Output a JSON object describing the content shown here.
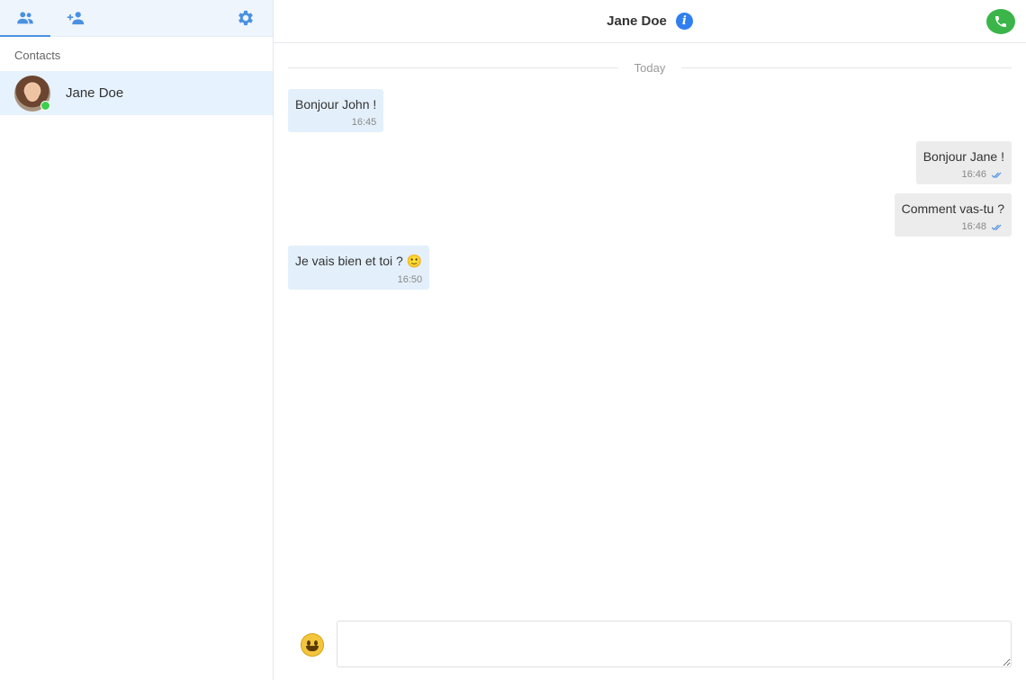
{
  "sidebar": {
    "section_label": "Contacts",
    "contacts": [
      {
        "name": "Jane Doe",
        "online": true
      }
    ]
  },
  "chat": {
    "title": "Jane Doe",
    "date_divider": "Today",
    "messages": [
      {
        "direction": "in",
        "text": "Bonjour John !",
        "time": "16:45"
      },
      {
        "direction": "out",
        "text": "Bonjour Jane !",
        "time": "16:46",
        "read": true
      },
      {
        "direction": "out",
        "text": "Comment vas-tu ?",
        "time": "16:48",
        "read": true
      },
      {
        "direction": "in",
        "text": "Je vais bien et toi ? 🙂",
        "time": "16:50"
      }
    ],
    "composer": {
      "value": "",
      "placeholder": ""
    }
  },
  "colors": {
    "accent": "#4a90e2",
    "call": "#3bb54a",
    "incoming_bubble": "#e3f0fb",
    "outgoing_bubble": "#ececec"
  },
  "icons": {
    "contacts_tab": "people-icon",
    "add_contact_tab": "person-add-icon",
    "settings": "gear-icon",
    "info": "info-icon",
    "call": "phone-icon",
    "emoji": "emoji-icon",
    "read": "double-check-icon"
  }
}
